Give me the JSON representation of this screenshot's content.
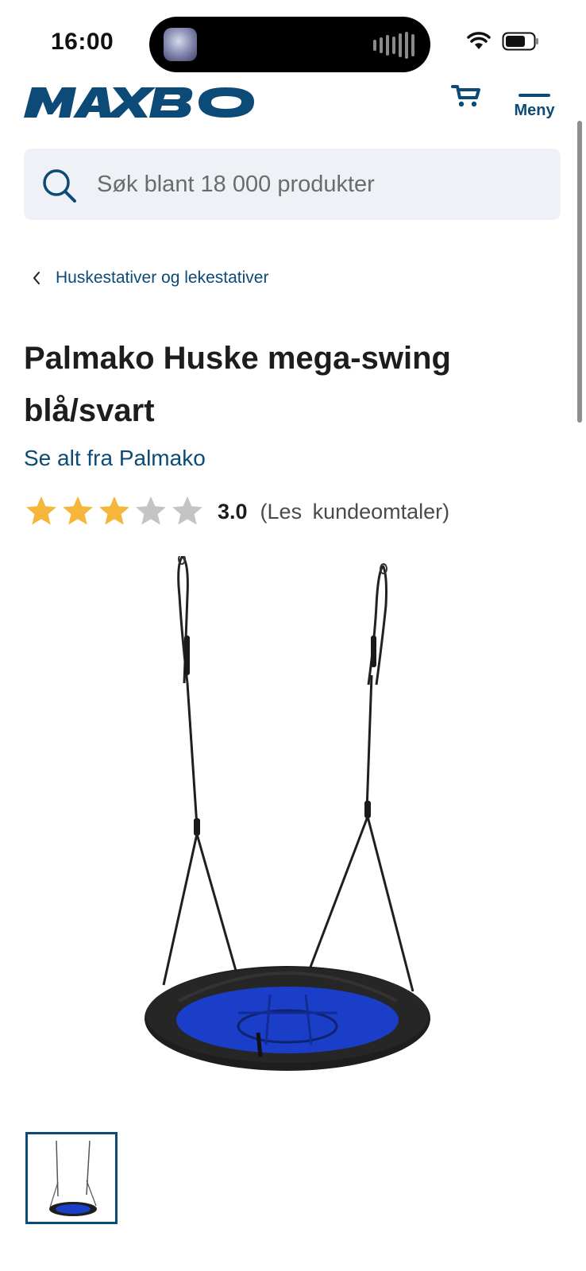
{
  "status_bar": {
    "time": "16:00"
  },
  "header": {
    "logo": "MAXBO",
    "menu_label": "Meny"
  },
  "search": {
    "placeholder": "Søk blant 18 000 produkter"
  },
  "breadcrumb": {
    "label": "Huskestativer og lekestativer"
  },
  "product": {
    "title": "Palmako Huske mega-swing blå/svart",
    "brand_link": "Se alt fra Palmako",
    "rating_value": "3.0",
    "reviews_link": "(Les  kundeomtaler)",
    "rating": 3,
    "rating_max": 5
  },
  "colors": {
    "brand_blue": "#0c4a78",
    "star_filled": "#f6b63c",
    "star_empty": "#c4c4c4",
    "seat_blue": "#1b3ec9"
  }
}
